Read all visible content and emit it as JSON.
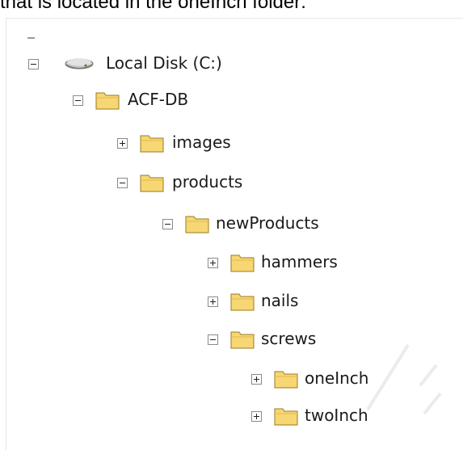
{
  "caption": "that is located in the oneInch folder:",
  "tree": {
    "root": {
      "label": "Local Disk (C:)",
      "icon": "hard-drive-icon",
      "state": "expanded"
    },
    "acf_db": {
      "label": "ACF-DB",
      "icon": "folder-icon",
      "state": "expanded"
    },
    "images": {
      "label": "images",
      "icon": "folder-icon",
      "state": "collapsed"
    },
    "products": {
      "label": "products",
      "icon": "folder-icon",
      "state": "expanded"
    },
    "newProducts": {
      "label": "newProducts",
      "icon": "folder-icon",
      "state": "expanded"
    },
    "hammers": {
      "label": "hammers",
      "icon": "folder-icon",
      "state": "collapsed"
    },
    "nails": {
      "label": "nails",
      "icon": "folder-icon",
      "state": "collapsed"
    },
    "screws": {
      "label": "screws",
      "icon": "folder-icon",
      "state": "expanded"
    },
    "oneInch": {
      "label": "oneInch",
      "icon": "folder-icon",
      "state": "collapsed"
    },
    "twoInch": {
      "label": "twoInch",
      "icon": "folder-icon",
      "state": "collapsed"
    }
  },
  "colors": {
    "folder_fill": "#f7d774",
    "folder_outline": "#9b7a1f",
    "toggle_border": "#8a8a8a",
    "text": "#1a1a1a"
  }
}
